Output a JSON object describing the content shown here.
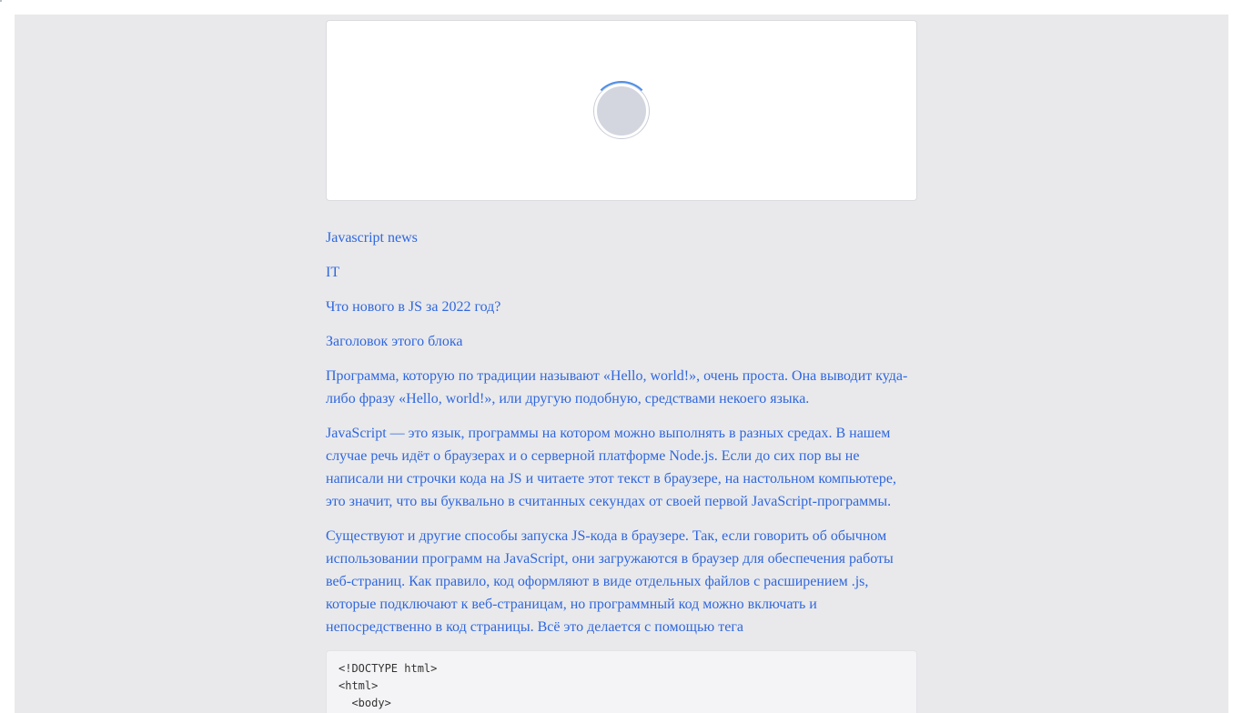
{
  "tags": {
    "category": "Javascript news",
    "section": "IT"
  },
  "article": {
    "title": "Что нового в JS за 2022 год?",
    "block_heading": "Заголовок этого блока",
    "paragraphs": [
      "Программа, которую по традиции называют «Hello, world!», очень проста. Она выводит куда-либо фразу «Hello, world!», или другую подобную, средствами некоего языка.",
      "JavaScript — это язык, программы на котором можно выполнять в разных средах. В нашем случае речь идёт о браузерах и о серверной платформе Node.js. Если до сих пор вы не написали ни строчки кода на JS и читаете этот текст в браузере, на настольном компьютере, это значит, что вы буквально в считанных секундах от своей первой JavaScript-программы.",
      "Существуют и другие способы запуска JS-кода в браузере. Так, если говорить об обычном использовании программ на JavaScript, они загружаются в браузер для обеспечения работы веб-страниц. Как правило, код оформляют в виде отдельных файлов с расширением .js, которые подключают к веб-страницам, но программный код можно включать и непосредственно в код страницы. Всё это делается с помощью тега"
    ],
    "code": "<!DOCTYPE html>\n<html>\n  <body>\n    <p id=\"hello\"></p>"
  },
  "colors": {
    "link": "#2f67de",
    "page_background": "#e9e9eb",
    "spinner_accent": "#4e8fe8"
  }
}
